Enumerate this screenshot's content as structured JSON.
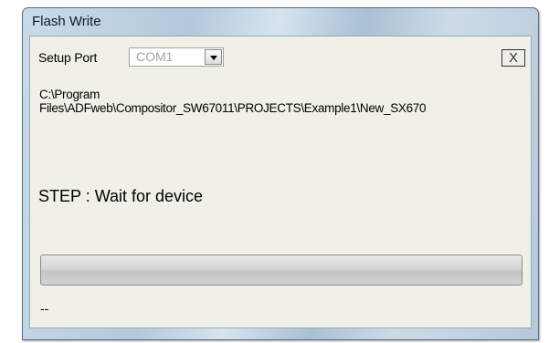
{
  "window": {
    "title": "Flash Write"
  },
  "setup_port": {
    "label": "Setup Port",
    "selected": "COM1"
  },
  "close_button": {
    "label": "X"
  },
  "file_path": {
    "line1": "C:\\Program",
    "line2": "Files\\ADFweb\\Compositor_SW67011\\PROJECTS\\Example1\\New_SX670"
  },
  "step_text": "STEP : Wait for device",
  "progress": {
    "value": 0
  },
  "status_text": "--",
  "colors": {
    "client_bg": "#f0f0e8",
    "title_text": "#0d1a2b",
    "combo_disabled_text": "#a3a3a3"
  }
}
